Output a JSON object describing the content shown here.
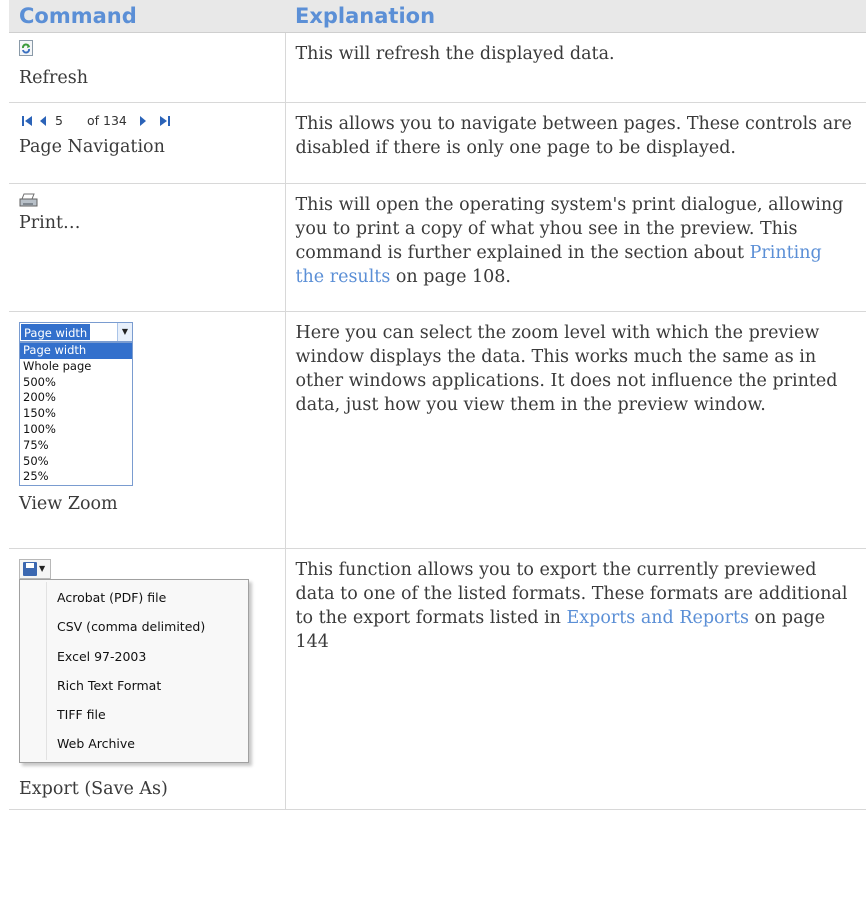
{
  "header": {
    "col1": "Command",
    "col2": "Explanation"
  },
  "rows": {
    "refresh": {
      "name": "Refresh",
      "text": "This will refresh the displayed data."
    },
    "page_nav": {
      "name": "Page Navigation",
      "current_page": "5",
      "of_pages": "of 134",
      "text": "This allows you to navigate between pages. These controls are disabled if there is only one page to be displayed."
    },
    "print": {
      "name": "Print…",
      "text_before": "This will open the operating system's print dialogue, allowing you to print a copy of what yhou see in the preview. This command is further explained in the section about ",
      "link": "Printing the results",
      "text_after": " on page 108."
    },
    "zoom": {
      "name": "View Zoom",
      "selected": "Page width",
      "options": [
        "Page width",
        "Whole page",
        "500%",
        "200%",
        "150%",
        "100%",
        "75%",
        "50%",
        "25%"
      ],
      "text": "Here you can select the zoom level with which the preview window displays the data. This works much the same as in other windows applications. It does not influence the printed data, just how you view them in the preview window."
    },
    "export": {
      "name": "Export (Save As)",
      "menu": [
        "Acrobat (PDF) file",
        "CSV (comma delimited)",
        "Excel 97-2003",
        "Rich Text Format",
        "TIFF file",
        "Web Archive"
      ],
      "text_before": "This function allows you to export the currently previewed data to one of the listed formats. These formats are additional to the export formats listed in ",
      "link": "Exports and Reports",
      "text_after": " on page 144"
    }
  },
  "colors": {
    "accent": "#5b8fd6",
    "header_bg": "#e8e8e8",
    "menu_highlight": "#3370cc"
  },
  "icons": [
    "refresh-icon",
    "first-page-icon",
    "prev-page-icon",
    "next-page-icon",
    "last-page-icon",
    "printer-icon",
    "save-icon"
  ]
}
